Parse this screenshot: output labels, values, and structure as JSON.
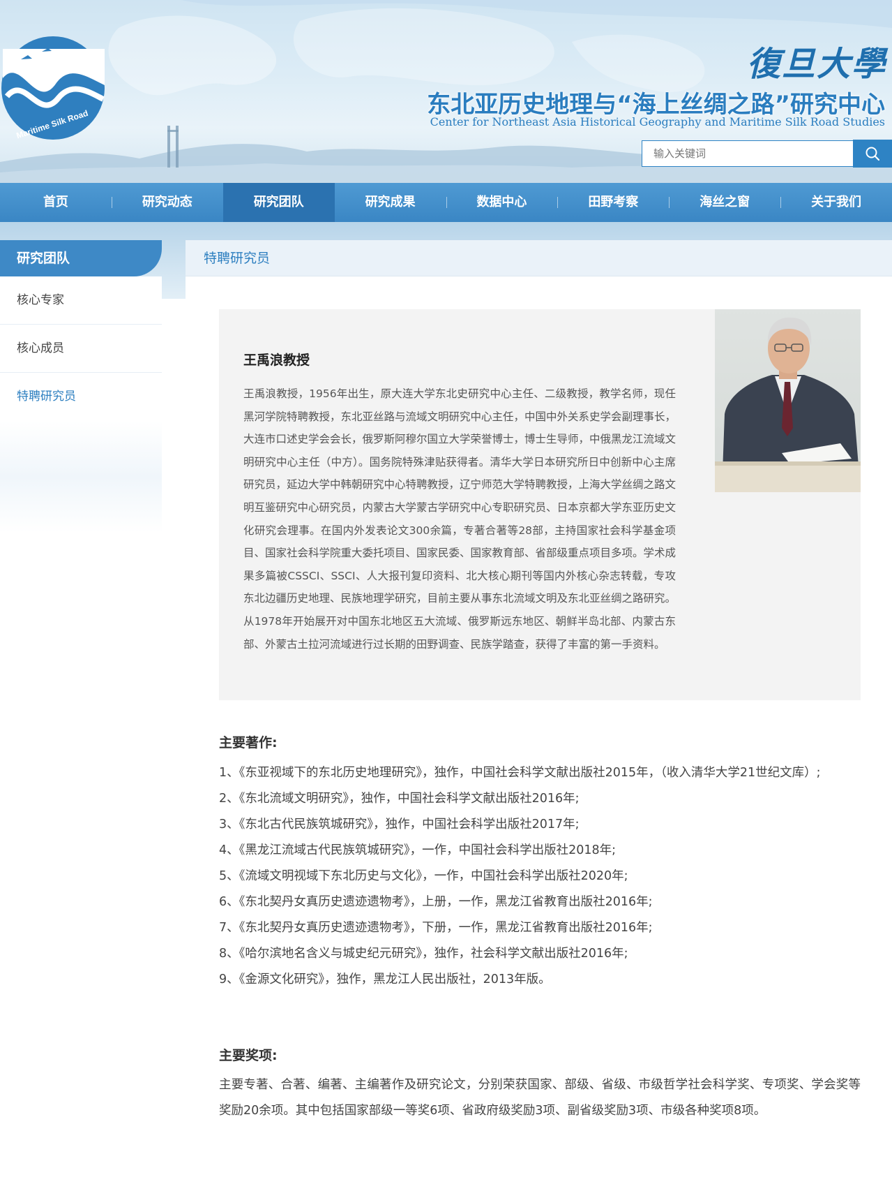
{
  "header": {
    "logo_text": "Maritime Silk Road",
    "university_name": "復旦大學",
    "center_name_cn": "东北亚历史地理与“海上丝绸之路”研究中心",
    "center_name_en": "Center for Northeast Asia Historical Geography and Maritime Silk Road Studies",
    "search_placeholder": "输入关键词"
  },
  "nav": {
    "items": [
      "首页",
      "研究动态",
      "研究团队",
      "研究成果",
      "数据中心",
      "田野考察",
      "海丝之窗",
      "关于我们"
    ],
    "active": "研究团队"
  },
  "sidebar": {
    "title": "研究团队",
    "items": [
      "核心专家",
      "核心成员",
      "特聘研究员"
    ],
    "active": "特聘研究员"
  },
  "main": {
    "title": "特聘研究员"
  },
  "profile": {
    "name": "王禹浪教授",
    "bio": "王禹浪教授，1956年出生，原大连大学东北史研究中心主任、二级教授，教学名师，现任黑河学院特聘教授，东北亚丝路与流域文明研究中心主任，中国中外关系史学会副理事长，大连市口述史学会会长，俄罗斯阿穆尔国立大学荣誉博士，博士生导师，中俄黑龙江流域文明研究中心主任（中方）。国务院特殊津贴获得者。清华大学日本研究所日中创新中心主席研究员，延边大学中韩朝研究中心特聘教授，辽宁师范大学特聘教授，上海大学丝绸之路文明互鉴研究中心研究员，内蒙古大学蒙古学研究中心专职研究员、日本京都大学东亚历史文化研究会理事。在国内外发表论文300余篇，专著合著等28部，主持国家社会科学基金项目、国家社会科学院重大委托项目、国家民委、国家教育部、省部级重点项目多项。学术成果多篇被CSSCI、SSCI、人大报刊复印资料、北大核心期刊等国内外核心杂志转载，专攻东北边疆历史地理、民族地理学研究，目前主要从事东北流域文明及东北亚丝绸之路研究。 从1978年开始展开对中国东北地区五大流域、俄罗斯远东地区、朝鲜半岛北部、内蒙古东部、外蒙古土拉河流域进行过长期的田野调查、民族学踏查，获得了丰富的第一手资料。"
  },
  "works": {
    "heading": "主要著作:",
    "items": [
      "1、《东亚视域下的东北历史地理研究》，独作，中国社会科学文献出版社2015年，（收入清华大学21世纪文库）;",
      "2、《东北流域文明研究》，独作，中国社会科学文献出版社2016年;",
      "3、《东北古代民族筑城研究》，独作，中国社会科学出版社2017年;",
      "4、《黑龙江流域古代民族筑城研究》，一作，中国社会科学出版社2018年;",
      "5、《流域文明视域下东北历史与文化》，一作，中国社会科学出版社2020年;",
      "6、《东北契丹女真历史遗迹遗物考》，上册，一作，黑龙江省教育出版社2016年;",
      "7、《东北契丹女真历史遗迹遗物考》，下册，一作，黑龙江省教育出版社2016年;",
      "8、《哈尔滨地名含义与城史纪元研究》，独作，社会科学文献出版社2016年;",
      "9、《金源文化研究》，独作，黑龙江人民出版社，2013年版。"
    ]
  },
  "awards": {
    "heading": "主要奖项:",
    "text": "主要专著、合著、编著、主编著作及研究论文，分别荣获国家、部级、省级、市级哲学社会科学奖、专项奖、学会奖等奖励20余项。其中包括国家部级一等奖6项、省政府级奖励3项、副省级奖励3项、市级各种奖项8项。"
  },
  "colors": {
    "primary_blue": "#3e89c6",
    "nav_active": "#2b72b0",
    "link_blue": "#2d7fc0"
  }
}
